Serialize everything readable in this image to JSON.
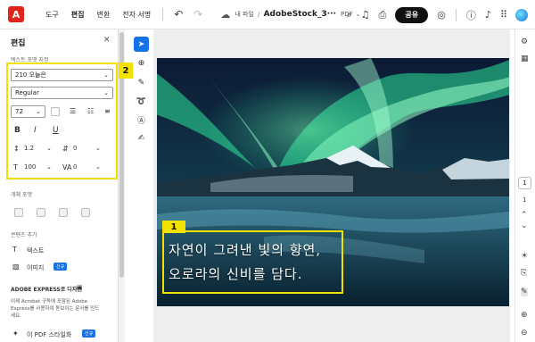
{
  "topbar": {
    "logo_label": "A",
    "menu": [
      "도구",
      "편집",
      "변환",
      "전자 서명"
    ],
    "breadcrumb_root": "내 파일",
    "filename": "AdobeStock_3···",
    "filetype": "PDF",
    "share_label": "공유"
  },
  "panel": {
    "title": "편집",
    "text_format_label": "텍스트 포맷 지정",
    "font_name": "210 오늘은",
    "font_style": "Regular",
    "font_size": "72",
    "line_spacing": "1.2",
    "char_spacing": "0",
    "scale": "100",
    "baseline": "0",
    "object_label": "개체 포맷",
    "add_content_label": "콘텐츠 추가",
    "add_text": "텍스트",
    "add_image": "이미지",
    "new_badge": "신규",
    "express_title": "ADOBE EXPRESS로 디자인",
    "express_desc_1": "이제 Acrobat 구독에 포함된 Adobe",
    "express_desc_2": "Express를 사용하여 돋보이는 문서를 만드",
    "express_desc_3": "세요.",
    "pdf_stamp": "이 PDF 스타일화",
    "bold": "B",
    "italic": "I",
    "underline": "U"
  },
  "callouts": {
    "one": "1",
    "two": "2"
  },
  "canvas": {
    "line1": "자연이 그려낸 빛의 향연,",
    "line2": "오로라의 신비를 담다."
  },
  "rail": {
    "page_current": "1",
    "page_total": "1"
  },
  "colors": {
    "accent": "#1473e6",
    "highlight": "#f3e100",
    "brand": "#e1251b"
  }
}
